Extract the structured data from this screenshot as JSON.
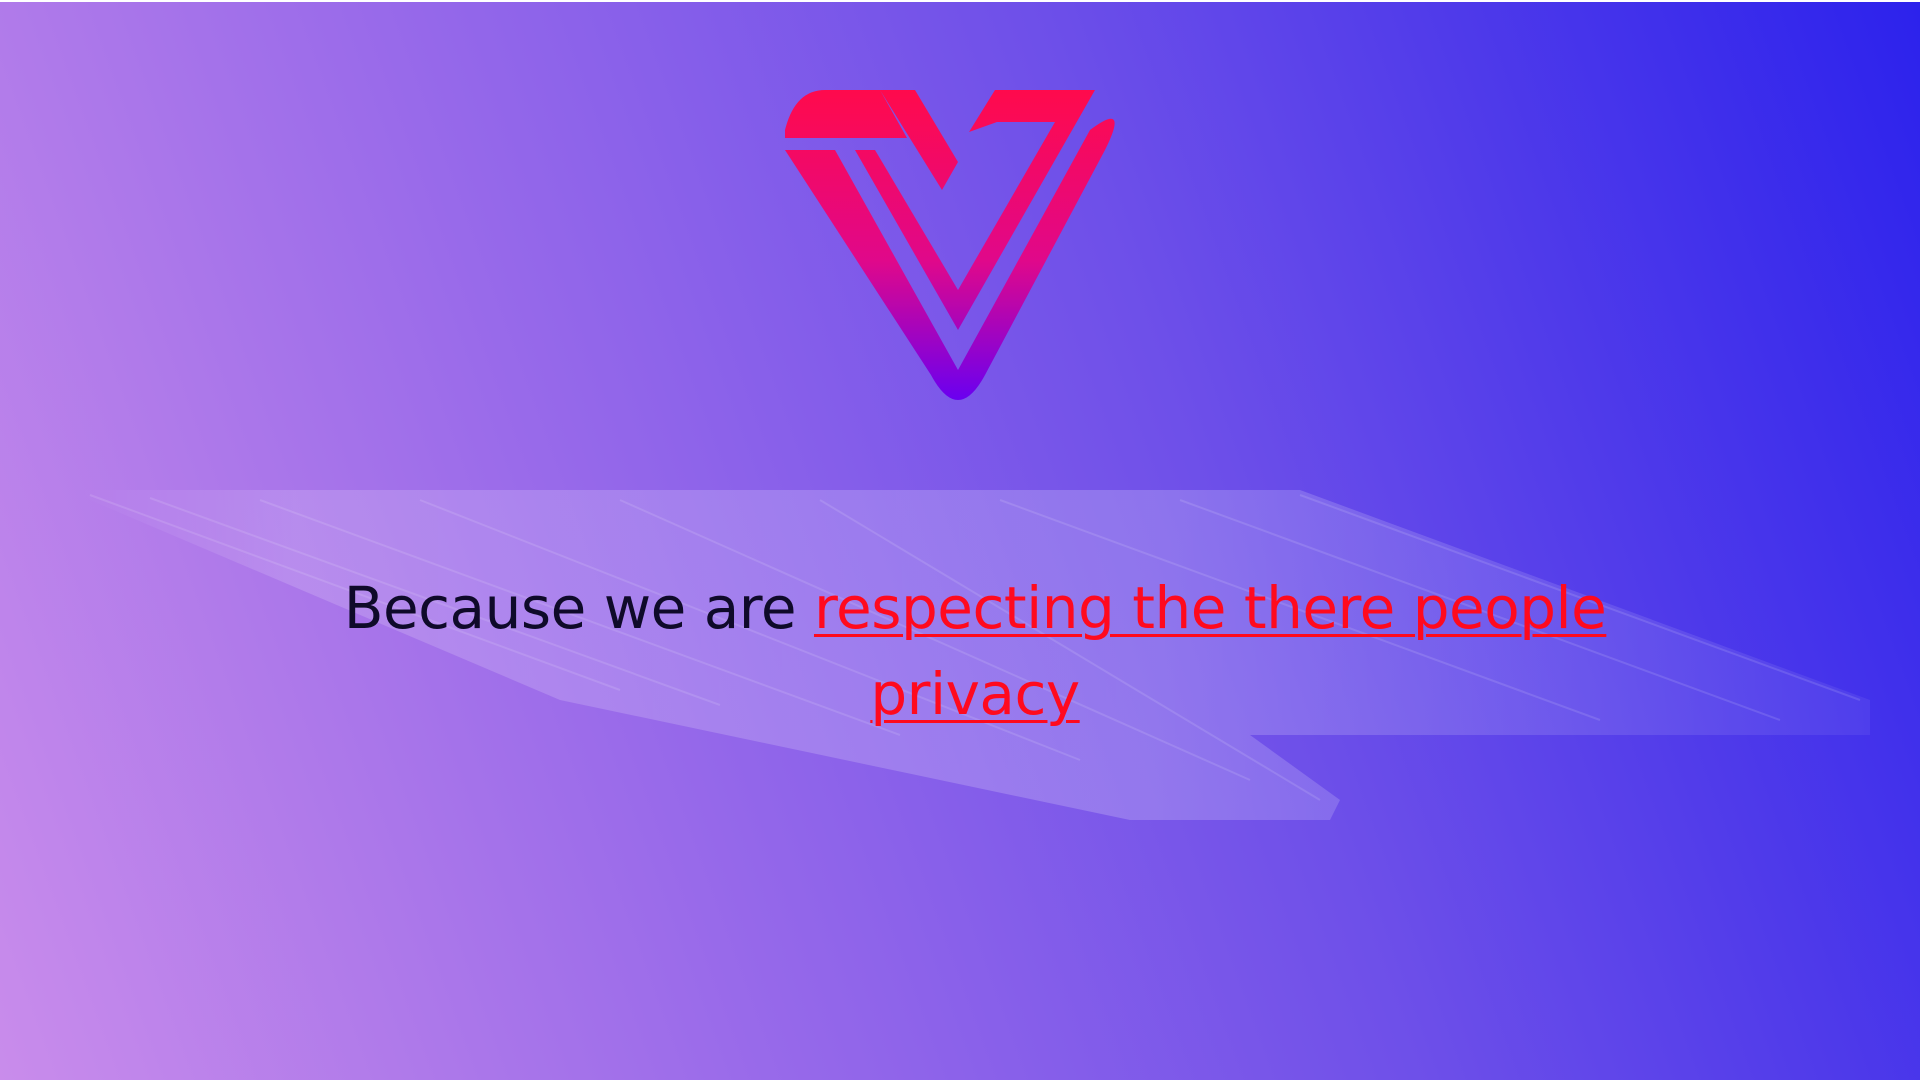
{
  "brand": {
    "logo_icon": "v-heart-logo-icon",
    "logo_top_color": "#ff0a4c",
    "logo_bottom_color": "#6a00f0"
  },
  "background": {
    "gradient_start": "#c98ceb",
    "gradient_end": "#2c22ec"
  },
  "message": {
    "lead_text": "Because we are ",
    "link_text": "respecting the there people privacy",
    "link_color": "#ff0a1e"
  }
}
